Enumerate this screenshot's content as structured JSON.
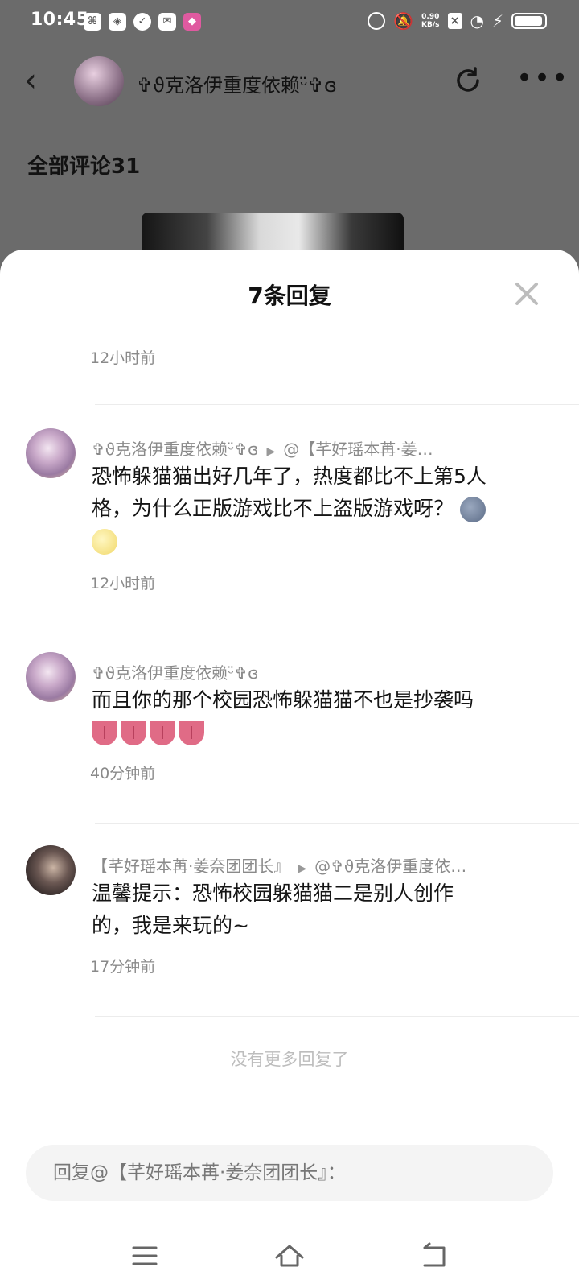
{
  "status_bar": {
    "time": "10:45",
    "net_speed_value": "0.90",
    "net_speed_unit": "KB/s",
    "battery_level": 0.95
  },
  "header": {
    "username": "✞ϑ克洛伊重度依赖ᵕ̈✞ɞ"
  },
  "comments_section": {
    "label": "全部评论31"
  },
  "sheet": {
    "title": "7条回复",
    "first_time": "12小时前",
    "replies": [
      {
        "author": "✞ϑ克洛伊重度依赖ᵕ̈✞ɞ",
        "reply_to": "@【芊好瑶本苒·姜…",
        "text_line1": "恐怖躲猫猫出好几年了，热度都比不上第5人",
        "text_line2": "格，为什么正版游戏比不上盗版游戏呀？",
        "time": "12小时前"
      },
      {
        "author": "✞ϑ克洛伊重度依赖ᵕ̈✞ɞ",
        "text_line1": "而且你的那个校园恐怖躲猫猫不也是抄袭吗",
        "time": "40分钟前"
      },
      {
        "author": "【芊好瑶本苒·姜奈团团长』",
        "reply_to": "@✞ϑ克洛伊重度依…",
        "text_line1": "温馨提示：恐怖校园躲猫猫二是别人创作",
        "text_line2": "的，我是来玩的~",
        "time": "17分钟前"
      }
    ],
    "no_more": "没有更多回复了",
    "input_placeholder": "回复@【芊好瑶本苒·姜奈团团长』："
  }
}
